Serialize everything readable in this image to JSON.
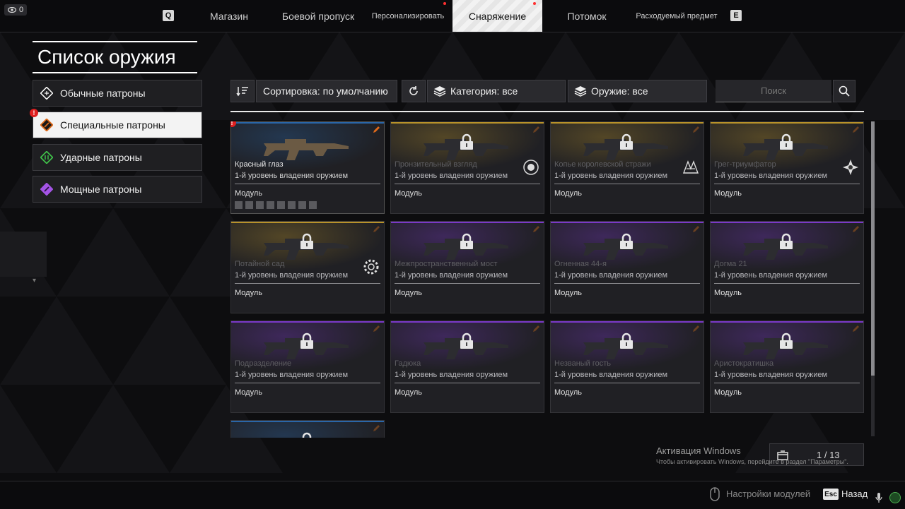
{
  "topbar": {
    "viewer_count": "0",
    "key_left": "Q",
    "key_right": "E",
    "tabs": [
      {
        "label": "Магазин",
        "active": false,
        "dot": false
      },
      {
        "label": "Боевой пропуск",
        "active": false,
        "dot": false
      },
      {
        "label": "Персонализировать",
        "active": false,
        "dot": true
      },
      {
        "label": "Снаряжение",
        "active": true,
        "dot": true
      },
      {
        "label": "Потомок",
        "active": false,
        "dot": false
      },
      {
        "label": "Расходуемый предмет",
        "active": false,
        "dot": false
      }
    ]
  },
  "page": {
    "title": "Список оружия"
  },
  "categories": [
    {
      "label": "Обычные патроны",
      "active": false,
      "icon": "regular-ammo-icon",
      "color": "#ffffff",
      "alert": false
    },
    {
      "label": "Специальные патроны",
      "active": true,
      "icon": "special-ammo-icon",
      "color": "#e06a1a",
      "alert": true
    },
    {
      "label": "Ударные патроны",
      "active": false,
      "icon": "impact-ammo-icon",
      "color": "#3fbf4a",
      "alert": false
    },
    {
      "label": "Мощные патроны",
      "active": false,
      "icon": "high-power-ammo-icon",
      "color": "#a454e6",
      "alert": false
    }
  ],
  "filters": {
    "sort": "Сортировка: по умолчанию",
    "category": "Категория: все",
    "weapon": "Оружие: все",
    "search_placeholder": "Поиск"
  },
  "weapons": [
    {
      "name": "Красный глаз",
      "level": "1-й уровень владения оружием",
      "module": "Модуль",
      "locked": false,
      "rarity": "#2a66a8",
      "alert": true,
      "badge": ""
    },
    {
      "name": "Пронзительный взгляд",
      "level": "1-й уровень владения оружием",
      "module": "Модуль",
      "locked": true,
      "rarity": "#b8922a",
      "alert": false,
      "badge": "gear-emblem-icon"
    },
    {
      "name": "Копье королевской стражи",
      "level": "1-й уровень владения оружием",
      "module": "Модуль",
      "locked": true,
      "rarity": "#b8922a",
      "alert": false,
      "badge": "crown-emblem-icon"
    },
    {
      "name": "Грег-триумфатор",
      "level": "1-й уровень владения оружием",
      "module": "Модуль",
      "locked": true,
      "rarity": "#b8922a",
      "alert": false,
      "badge": "star-emblem-icon"
    },
    {
      "name": "Потайной сад",
      "level": "1-й уровень владения оружием",
      "module": "Модуль",
      "locked": true,
      "rarity": "#b8922a",
      "alert": false,
      "badge": "cog-emblem-icon"
    },
    {
      "name": "Межпространственный мост",
      "level": "1-й уровень владения оружием",
      "module": "Модуль",
      "locked": true,
      "rarity": "#7a38c8",
      "alert": false,
      "badge": ""
    },
    {
      "name": "Огненная 44-я",
      "level": "1-й уровень владения оружием",
      "module": "Модуль",
      "locked": true,
      "rarity": "#7a38c8",
      "alert": false,
      "badge": ""
    },
    {
      "name": "Догма 21",
      "level": "1-й уровень владения оружием",
      "module": "Модуль",
      "locked": true,
      "rarity": "#7a38c8",
      "alert": false,
      "badge": ""
    },
    {
      "name": "Подразделение",
      "level": "1-й уровень владения оружием",
      "module": "Модуль",
      "locked": true,
      "rarity": "#7a38c8",
      "alert": false,
      "badge": ""
    },
    {
      "name": "Гадюка",
      "level": "1-й уровень владения оружием",
      "module": "Модуль",
      "locked": true,
      "rarity": "#7a38c8",
      "alert": false,
      "badge": ""
    },
    {
      "name": "Незваный гость",
      "level": "1-й уровень владения оружием",
      "module": "Модуль",
      "locked": true,
      "rarity": "#7a38c8",
      "alert": false,
      "badge": ""
    },
    {
      "name": "Аристократишка",
      "level": "1-й уровень владения оружием",
      "module": "Модуль",
      "locked": true,
      "rarity": "#7a38c8",
      "alert": false,
      "badge": ""
    },
    {
      "name": "",
      "level": "",
      "module": "",
      "locked": true,
      "rarity": "#2a66a8",
      "alert": false,
      "badge": ""
    }
  ],
  "module_slots": 8,
  "watermark": {
    "title": "Активация Windows",
    "subtitle": "Чтобы активировать Windows, перейдите в раздел \"Параметры\"."
  },
  "pager": {
    "text": "1 / 13"
  },
  "bottombar": {
    "module_settings": "Настройки модулей",
    "esc_key": "Esc",
    "back": "Назад"
  },
  "colors": {
    "accent_active": "#f2f2f2",
    "alert": "#e02020",
    "legendary": "#b8922a",
    "rare": "#7a38c8",
    "standard": "#2a66a8"
  }
}
